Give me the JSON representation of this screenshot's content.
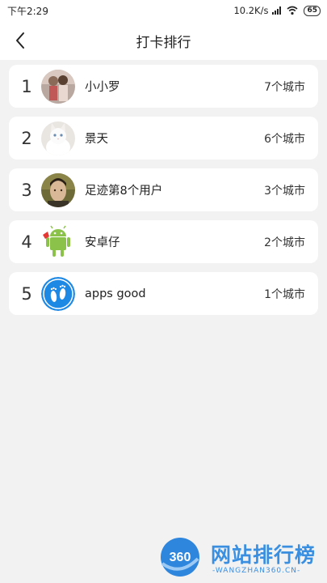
{
  "status_bar": {
    "time": "下午2:29",
    "net_speed": "10.2K/s",
    "battery": "65"
  },
  "header": {
    "title": "打卡排行",
    "back_icon": "chevron-left-icon"
  },
  "ranking": [
    {
      "rank": "1",
      "name": "小小罗",
      "cities": "7个城市",
      "avatar": "photo-avatar-couple"
    },
    {
      "rank": "2",
      "name": "景天",
      "cities": "6个城市",
      "avatar": "photo-avatar-white-cat"
    },
    {
      "rank": "3",
      "name": "足迹第8个用户",
      "cities": "3个城市",
      "avatar": "photo-avatar-man-portrait"
    },
    {
      "rank": "4",
      "name": "安卓仔",
      "cities": "2个城市",
      "avatar": "android-robot-avatar"
    },
    {
      "rank": "5",
      "name": "apps good",
      "cities": "1个城市",
      "avatar": "footprints-app-logo"
    }
  ],
  "watermark": {
    "logo_text": "360",
    "title": "网站排行榜",
    "subtitle": "-WANGZHAN360.CN-"
  },
  "colors": {
    "background": "#f2f2f2",
    "card": "#ffffff",
    "watermark_blue": "#3b8fe0"
  }
}
